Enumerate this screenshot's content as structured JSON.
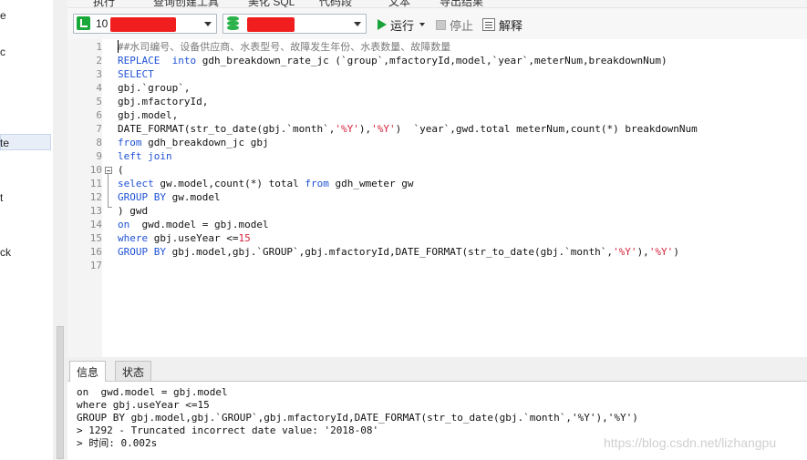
{
  "left_panel": {
    "fragments": [
      "e",
      "c",
      "te",
      "t",
      "ck"
    ]
  },
  "top_partial": {
    "items": [
      "执行",
      "查询创建工具",
      "美化 SQL",
      "代码段",
      "文本",
      "导出结果"
    ]
  },
  "toolbar": {
    "connection_value": "10",
    "database_value": "",
    "run_label": "运行",
    "stop_label": "停止",
    "explain_label": "解释"
  },
  "editor": {
    "line_numbers": [
      "1",
      "2",
      "3",
      "4",
      "5",
      "6",
      "7",
      "8",
      "9",
      "10",
      "11",
      "12",
      "13",
      "14",
      "15",
      "16",
      "17"
    ],
    "lines": [
      [
        {
          "t": "##水司编号、设备供应商、水表型号、故障发生年份、水表数量、故障数量",
          "c": "cmt"
        }
      ],
      [
        {
          "t": "REPLACE  into",
          "c": "kw"
        },
        {
          "t": " gdh_breakdown_rate_jc (`group`,mfactoryId,model,`year`,meterNum,breakdownNum)",
          "c": ""
        }
      ],
      [
        {
          "t": "SELECT",
          "c": "kw"
        }
      ],
      [
        {
          "t": "gbj.`group`,",
          "c": ""
        }
      ],
      [
        {
          "t": "gbj.mfactoryId,",
          "c": ""
        }
      ],
      [
        {
          "t": "gbj.model,",
          "c": ""
        }
      ],
      [
        {
          "t": "DATE_FORMAT(str_to_date(gbj.`month`,",
          "c": ""
        },
        {
          "t": "'%Y'",
          "c": "str"
        },
        {
          "t": "),",
          "c": ""
        },
        {
          "t": "'%Y'",
          "c": "str"
        },
        {
          "t": ")  `year`,gwd.total meterNum,count(*) breakdownNum",
          "c": ""
        }
      ],
      [
        {
          "t": "from",
          "c": "kw"
        },
        {
          "t": " gdh_breakdown_jc gbj",
          "c": ""
        }
      ],
      [
        {
          "t": "left join",
          "c": "kw"
        }
      ],
      [
        {
          "t": "(",
          "c": ""
        }
      ],
      [
        {
          "t": "select",
          "c": "kw"
        },
        {
          "t": " gw.model,count(*) total ",
          "c": ""
        },
        {
          "t": "from",
          "c": "kw"
        },
        {
          "t": " gdh_wmeter gw",
          "c": ""
        }
      ],
      [
        {
          "t": "GROUP BY",
          "c": "kw"
        },
        {
          "t": " gw.model",
          "c": ""
        }
      ],
      [
        {
          "t": ") gwd",
          "c": ""
        }
      ],
      [
        {
          "t": "on",
          "c": "kw"
        },
        {
          "t": "  gwd.model = gbj.model",
          "c": ""
        }
      ],
      [
        {
          "t": "where",
          "c": "kw"
        },
        {
          "t": " gbj.useYear <=",
          "c": ""
        },
        {
          "t": "15",
          "c": "str"
        }
      ],
      [
        {
          "t": "GROUP BY",
          "c": "kw"
        },
        {
          "t": " gbj.model,gbj.`GROUP`,gbj.mfactoryId,DATE_FORMAT(str_to_date(gbj.`month`,",
          "c": ""
        },
        {
          "t": "'%Y'",
          "c": "str"
        },
        {
          "t": "),",
          "c": ""
        },
        {
          "t": "'%Y'",
          "c": "str"
        },
        {
          "t": ")",
          "c": ""
        }
      ],
      []
    ]
  },
  "bottom": {
    "tabs": [
      "信息",
      "状态"
    ],
    "output_lines": [
      "on  gwd.model = gbj.model",
      "where gbj.useYear <=15",
      "GROUP BY gbj.model,gbj.`GROUP`,gbj.mfactoryId,DATE_FORMAT(str_to_date(gbj.`month`,'%Y'),'%Y')",
      "> 1292 - Truncated incorrect date value: '2018-08'",
      "> 时间: 0.002s"
    ]
  },
  "watermark": "https://blog.csdn.net/lizhangpu",
  "colors": {
    "keyword": "#1f52d6",
    "string": "#d4233b",
    "comment": "#7a7a7a",
    "run": "#1aa33b",
    "redaction": "#f01e1e"
  }
}
